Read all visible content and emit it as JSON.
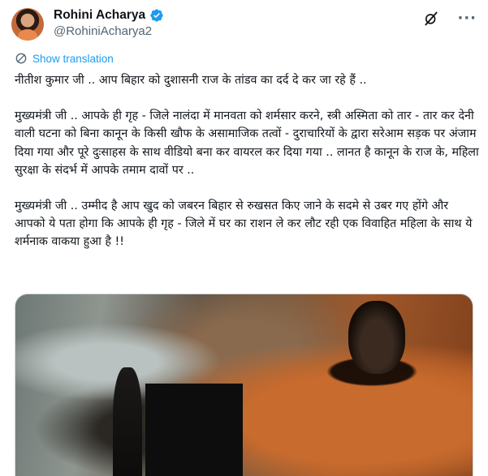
{
  "author": {
    "display_name": "Rohini Acharya",
    "handle": "@RohiniAcharya2",
    "avatar_icon": "profile-photo",
    "verified_icon": "verified-badge-icon",
    "verified_color": "#1d9bf0"
  },
  "header": {
    "grok_icon": "grok-icon",
    "more_icon": "more-options-icon",
    "more_glyph": "···"
  },
  "translation": {
    "icon": "globe-icon",
    "label": "Show translation",
    "link_color": "#1d9bf0"
  },
  "tweet": {
    "lines": [
      "नीतीश कुमार जी .. आप बिहार को दुशासनी राज के तांडव का दर्द दे कर जा रहे हैं  ..",
      "मुख्यमंत्री जी .. आपके ही गृह - जिले नालंदा में मानवता को शर्मसार करने, स्त्री अस्मिता को तार - तार कर देनी वाली घटना को बिना कानून के किसी खौफ के असामाजिक तत्वों - दुराचारियों के द्वारा सरेआम सड़क पर अंजाम दिया गया और पूरे दुःसाहस के साथ वीडियो बना कर वायरल कर दिया गया .. लानत है कानून के राज के, महिला सुरक्षा के संदर्भ में आपके तमाम दावों पर ..",
      "मुख्यमंत्री जी .. उम्मीद है आप खुद को जबरन बिहार से रुखसत किए जाने के सदमे से उबर गए होंगे और आपको ये पता होगा कि आपके ही गृह - जिले में घर का राशन ले कर लौट रही एक विवाहित महिला के साथ ये शर्मनाक वाकया हुआ है !!"
    ]
  },
  "media": {
    "type": "blurred-video-still"
  }
}
